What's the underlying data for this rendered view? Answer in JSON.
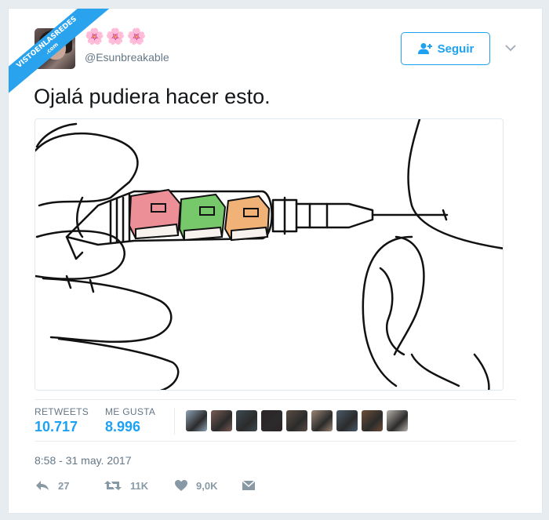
{
  "watermark": {
    "line1": "VISTOENLASREDES",
    "line2": ".com"
  },
  "tweet": {
    "display_name_emoji": "🌸🌸🌸",
    "handle": "@Esunbreakable",
    "text": "Ojalá pudiera hacer esto.",
    "follow_label": "Seguir",
    "timestamp": "8:58 - 31 may. 2017"
  },
  "stats": {
    "retweets_label": "RETWEETS",
    "retweets_value": "10.717",
    "likes_label": "ME GUSTA",
    "likes_value": "8.996",
    "liker_colors": [
      "#8fa3b8",
      "#7a5c55",
      "#3c4a52",
      "#2e2426",
      "#5b4c44",
      "#9c8676",
      "#4a5a6a",
      "#6e4e3a",
      "#b8b2aa"
    ]
  },
  "actions": {
    "reply_count": "27",
    "retweet_count": "11K",
    "like_count": "9,0K"
  },
  "colors": {
    "accent": "#1da1f2",
    "muted": "#657786",
    "text": "#14171a"
  },
  "icons": [
    "follow-user-icon",
    "chevron-down-icon",
    "reply-icon",
    "retweet-icon",
    "heart-icon",
    "dm-icon"
  ]
}
